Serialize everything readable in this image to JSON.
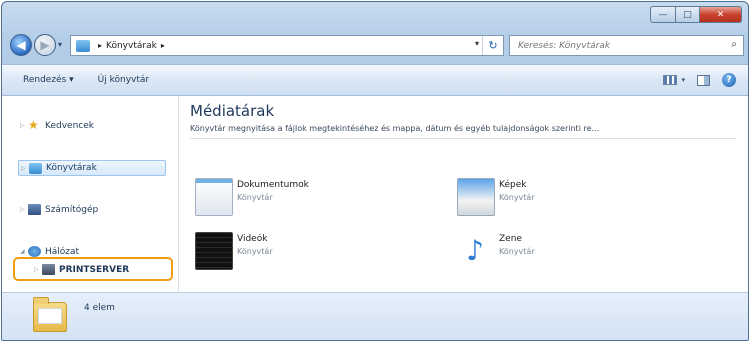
{
  "window": {
    "controls": {
      "minimize": "—",
      "maximize": "□",
      "close": "✕"
    }
  },
  "nav": {
    "back_icon": "arrow-left-icon",
    "forward_icon": "arrow-right-icon",
    "breadcrumb": [
      "Könyvtárak"
    ],
    "breadcrumb_sep": "▸",
    "refresh_glyph": "↻",
    "search_placeholder": "Keresés: Könyvtárak",
    "search_glyph": "⌕"
  },
  "toolbar": {
    "organize": "Rendezés ▾",
    "new_library": "Új könyvtár",
    "help": "?"
  },
  "sidebar": {
    "items": [
      {
        "label": "Kedvencek",
        "icon": "star-icon"
      },
      {
        "label": "Könyvtárak",
        "icon": "library-icon",
        "selected": true
      },
      {
        "label": "Számítógép",
        "icon": "computer-icon"
      },
      {
        "label": "Hálózat",
        "icon": "network-icon"
      },
      {
        "label": "PRINTSERVER",
        "icon": "server-icon"
      }
    ],
    "expander_collapsed": "▷",
    "expander_expanded": "◢"
  },
  "content": {
    "title": "Médiatárak",
    "subtitle": "Könyvtár megnyitása a fájlok megtekintéséhez és mappa, dátum és egyéb tulajdonságok szerinti re...",
    "libraries": [
      {
        "name": "Dokumentumok",
        "type": "Könyvtár",
        "icon": "documents-icon"
      },
      {
        "name": "Képek",
        "type": "Könyvtár",
        "icon": "pictures-icon"
      },
      {
        "name": "Videók",
        "type": "Könyvtár",
        "icon": "videos-icon"
      },
      {
        "name": "Zene",
        "type": "Könyvtár",
        "icon": "music-icon",
        "glyph": "♪"
      }
    ]
  },
  "status": {
    "count": "4 elem",
    "icon": "folder-icon"
  },
  "colors": {
    "frame": "#a9c5e4",
    "highlight": "#f39c12",
    "title": "#1e395b"
  }
}
